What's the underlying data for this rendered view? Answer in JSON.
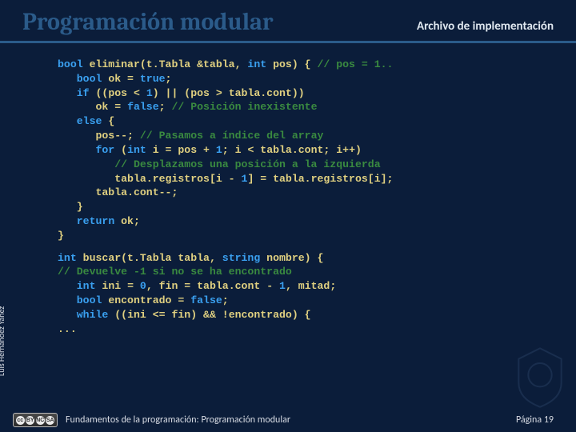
{
  "header": {
    "title": "Programación modular",
    "section": "Archivo de implementación"
  },
  "code": {
    "fn1": {
      "sig_type": "bool",
      "sig_name": " eliminar(t.Tabla &tabla, ",
      "sig_arg_type": "int",
      "sig_arg_rest": " pos) { ",
      "sig_cmt": "// pos = 1..",
      "l2a": "bool",
      "l2b": " ok = ",
      "l2c": "true",
      "l2d": ";",
      "l3a": "if",
      "l3b": " ((pos < ",
      "l3c": "1",
      "l3d": ") || (pos > tabla.cont))",
      "l4a": "ok = ",
      "l4b": "false",
      "l4c": "; ",
      "l4cmt": "// Posición inexistente",
      "l5a": "else",
      "l5b": " {",
      "l6a": "pos--; ",
      "l6cmt": "// Pasamos a índice del array",
      "l7a": "for",
      "l7b": " (",
      "l7c": "int",
      "l7d": " i = pos + ",
      "l7e": "1",
      "l7f": "; i < tabla.cont; i++)",
      "l8cmt": "// Desplazamos una posición a la izquierda",
      "l9a": "tabla.registros[i - ",
      "l9b": "1",
      "l9c": "] = tabla.registros[i];",
      "l10": "tabla.cont--;",
      "l11": "}",
      "l12a": "return",
      "l12b": " ok;",
      "l13": "}"
    },
    "fn2": {
      "sig_type": "int",
      "sig_name": " buscar(t.Tabla tabla, ",
      "sig_arg_type": "string",
      "sig_arg_rest": " nombre) {",
      "l2cmt": "// Devuelve -1 si no se ha encontrado",
      "l3a": "int",
      "l3b": " ini = ",
      "l3c": "0",
      "l3d": ", fin = tabla.cont - ",
      "l3e": "1",
      "l3f": ", mitad;",
      "l4a": "bool",
      "l4b": " encontrado = ",
      "l4c": "false",
      "l4d": ";",
      "l5a": "while",
      "l5b": " ((ini <= fin) && !encontrado) {",
      "l6": "..."
    }
  },
  "author": "Luis Hernández Yáñez",
  "footer": {
    "course": "Fundamentos de la programación: Programación modular",
    "page_label": "Página 19"
  },
  "cc_icons": [
    "cc",
    "BY",
    "NC",
    "SA"
  ]
}
